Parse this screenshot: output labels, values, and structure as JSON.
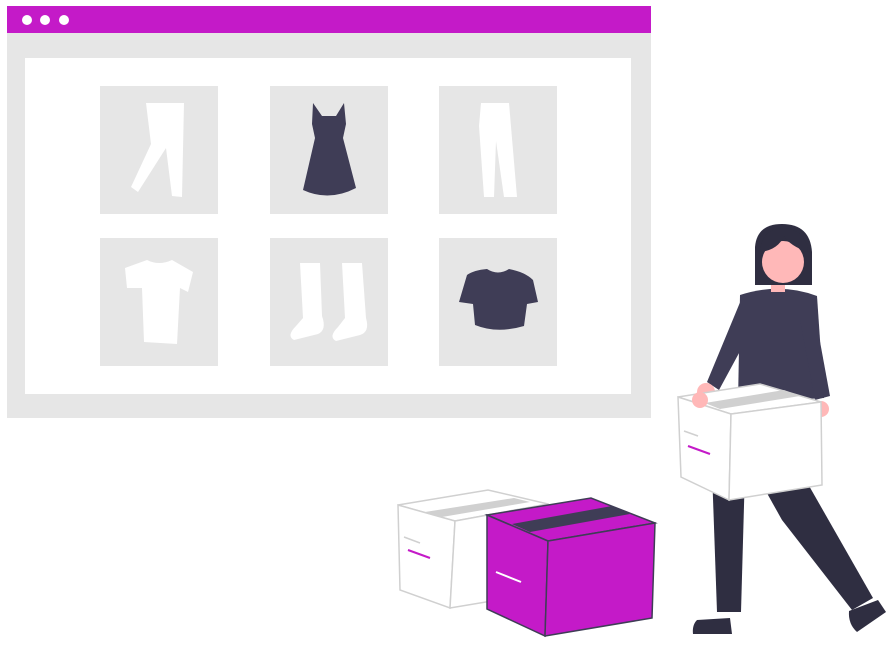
{
  "window": {
    "title_bar": {
      "color": "#c41ac8",
      "controls": [
        "dot",
        "dot",
        "dot"
      ]
    },
    "products": [
      {
        "icon": "pants-icon",
        "color": "#ffffff"
      },
      {
        "icon": "dress-icon",
        "color": "#3f3d56"
      },
      {
        "icon": "trousers-icon",
        "color": "#ffffff"
      },
      {
        "icon": "tshirt-icon",
        "color": "#ffffff"
      },
      {
        "icon": "boots-icon",
        "color": "#ffffff"
      },
      {
        "icon": "crop-top-icon",
        "color": "#3f3d56"
      }
    ]
  },
  "scene": {
    "person": "person-carrying-box",
    "boxes": [
      {
        "name": "white-box",
        "color": "#ffffff"
      },
      {
        "name": "magenta-box",
        "color": "#c41ac8"
      },
      {
        "name": "carried-box",
        "color": "#ffffff"
      }
    ]
  },
  "colors": {
    "accent": "#c41ac8",
    "dark": "#3f3d56",
    "panel": "#e6e6e6",
    "skin": "#ffb8b8"
  }
}
